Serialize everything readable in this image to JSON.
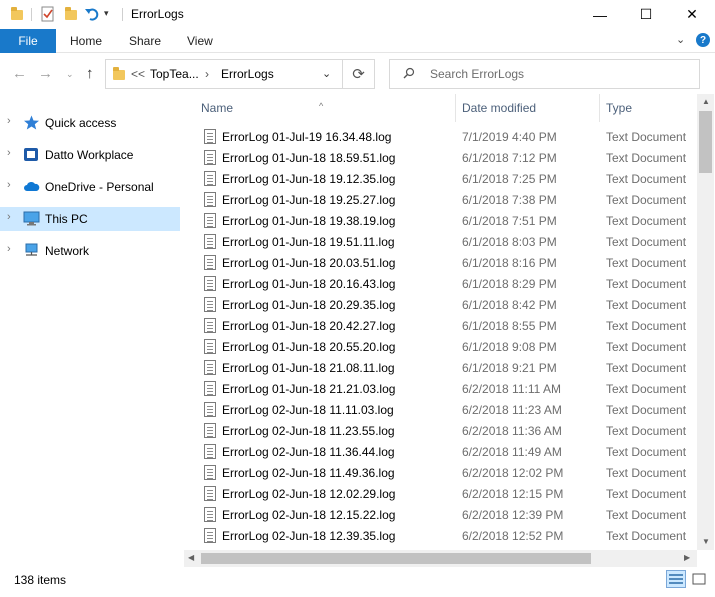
{
  "window": {
    "title": "ErrorLogs",
    "minimize": "—",
    "maximize": "☐",
    "close": "✕"
  },
  "ribbon": {
    "tabs": [
      "File",
      "Home",
      "Share",
      "View"
    ],
    "expand_icon": "chevron-down-icon",
    "help_label": "?"
  },
  "address": {
    "overflow": "<<",
    "crumbs": [
      "TopTea...",
      "ErrorLogs"
    ],
    "search_placeholder": "Search ErrorLogs"
  },
  "nav": {
    "items": [
      {
        "label": "Quick access",
        "icon": "star-icon"
      },
      {
        "label": "Datto Workplace",
        "icon": "datto-icon"
      },
      {
        "label": "OneDrive - Personal",
        "icon": "cloud-icon"
      },
      {
        "label": "This PC",
        "icon": "computer-icon",
        "selected": true
      },
      {
        "label": "Network",
        "icon": "network-icon"
      }
    ]
  },
  "columns": {
    "name": "Name",
    "date": "Date modified",
    "type": "Type"
  },
  "files": [
    {
      "name": "ErrorLog 01-Jul-19 16.34.48.log",
      "date": "7/1/2019 4:40 PM",
      "type": "Text Document"
    },
    {
      "name": "ErrorLog 01-Jun-18 18.59.51.log",
      "date": "6/1/2018 7:12 PM",
      "type": "Text Document"
    },
    {
      "name": "ErrorLog 01-Jun-18 19.12.35.log",
      "date": "6/1/2018 7:25 PM",
      "type": "Text Document"
    },
    {
      "name": "ErrorLog 01-Jun-18 19.25.27.log",
      "date": "6/1/2018 7:38 PM",
      "type": "Text Document"
    },
    {
      "name": "ErrorLog 01-Jun-18 19.38.19.log",
      "date": "6/1/2018 7:51 PM",
      "type": "Text Document"
    },
    {
      "name": "ErrorLog 01-Jun-18 19.51.11.log",
      "date": "6/1/2018 8:03 PM",
      "type": "Text Document"
    },
    {
      "name": "ErrorLog 01-Jun-18 20.03.51.log",
      "date": "6/1/2018 8:16 PM",
      "type": "Text Document"
    },
    {
      "name": "ErrorLog 01-Jun-18 20.16.43.log",
      "date": "6/1/2018 8:29 PM",
      "type": "Text Document"
    },
    {
      "name": "ErrorLog 01-Jun-18 20.29.35.log",
      "date": "6/1/2018 8:42 PM",
      "type": "Text Document"
    },
    {
      "name": "ErrorLog 01-Jun-18 20.42.27.log",
      "date": "6/1/2018 8:55 PM",
      "type": "Text Document"
    },
    {
      "name": "ErrorLog 01-Jun-18 20.55.20.log",
      "date": "6/1/2018 9:08 PM",
      "type": "Text Document"
    },
    {
      "name": "ErrorLog 01-Jun-18 21.08.11.log",
      "date": "6/1/2018 9:21 PM",
      "type": "Text Document"
    },
    {
      "name": "ErrorLog 01-Jun-18 21.21.03.log",
      "date": "6/2/2018 11:11 AM",
      "type": "Text Document"
    },
    {
      "name": "ErrorLog 02-Jun-18 11.11.03.log",
      "date": "6/2/2018 11:23 AM",
      "type": "Text Document"
    },
    {
      "name": "ErrorLog 02-Jun-18 11.23.55.log",
      "date": "6/2/2018 11:36 AM",
      "type": "Text Document"
    },
    {
      "name": "ErrorLog 02-Jun-18 11.36.44.log",
      "date": "6/2/2018 11:49 AM",
      "type": "Text Document"
    },
    {
      "name": "ErrorLog 02-Jun-18 11.49.36.log",
      "date": "6/2/2018 12:02 PM",
      "type": "Text Document"
    },
    {
      "name": "ErrorLog 02-Jun-18 12.02.29.log",
      "date": "6/2/2018 12:15 PM",
      "type": "Text Document"
    },
    {
      "name": "ErrorLog 02-Jun-18 12.15.22.log",
      "date": "6/2/2018 12:39 PM",
      "type": "Text Document"
    },
    {
      "name": "ErrorLog 02-Jun-18 12.39.35.log",
      "date": "6/2/2018 12:52 PM",
      "type": "Text Document"
    }
  ],
  "status": {
    "item_count": "138 items"
  },
  "colors": {
    "accent": "#1979ca",
    "selection": "#cce8ff",
    "header_text": "#4c607a",
    "secondary_text": "#6d6d6d"
  }
}
